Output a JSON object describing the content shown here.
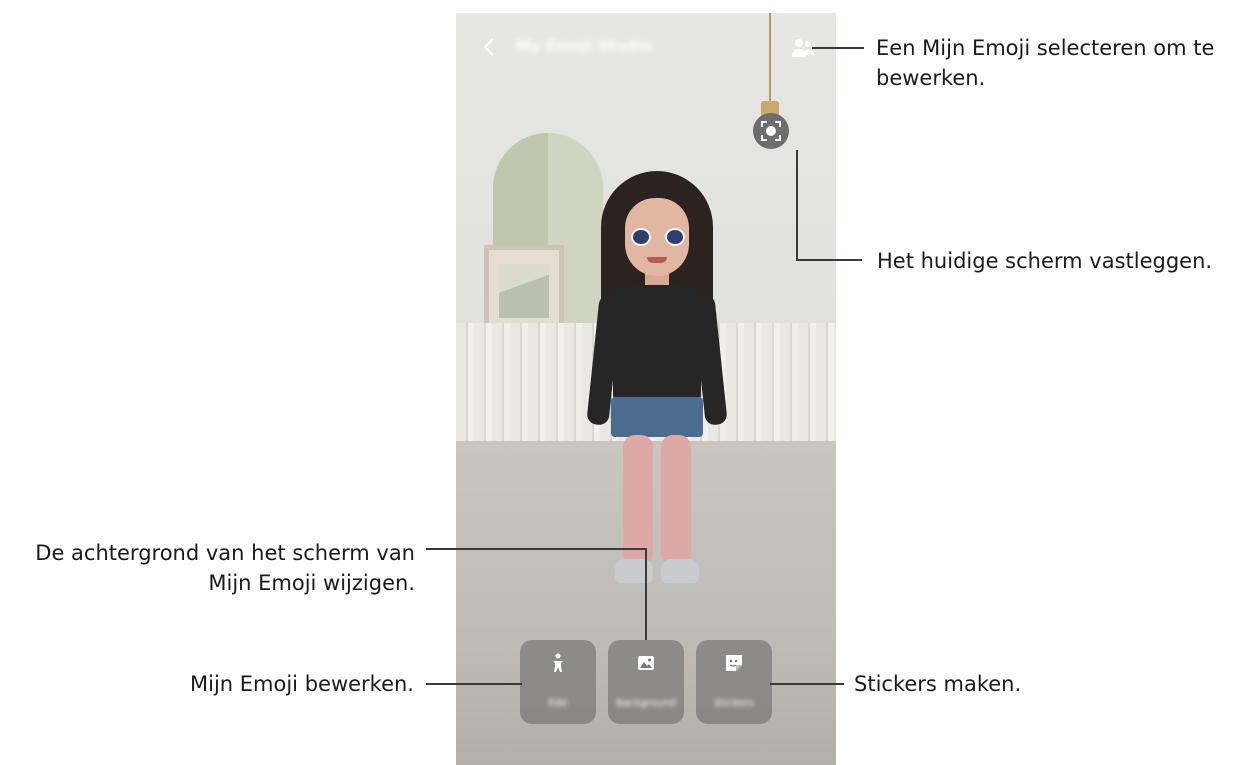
{
  "screen": {
    "header": {
      "title": "My Emoji Studio"
    },
    "buttons": [
      {
        "label": "Edit",
        "icon": "person-icon"
      },
      {
        "label": "Background",
        "icon": "image-icon"
      },
      {
        "label": "Stickers",
        "icon": "sticker-icon"
      }
    ]
  },
  "callouts": {
    "select": "Een Mijn Emoji selecteren om te bewerken.",
    "capture": "Het huidige scherm vastleggen.",
    "background": "De achtergrond van het scherm van Mijn Emoji wijzigen.",
    "edit": "Mijn Emoji bewerken.",
    "stickers": "Stickers maken."
  },
  "colors": {
    "button_bg": "#787878",
    "callout_line": "#3a3a3a"
  }
}
